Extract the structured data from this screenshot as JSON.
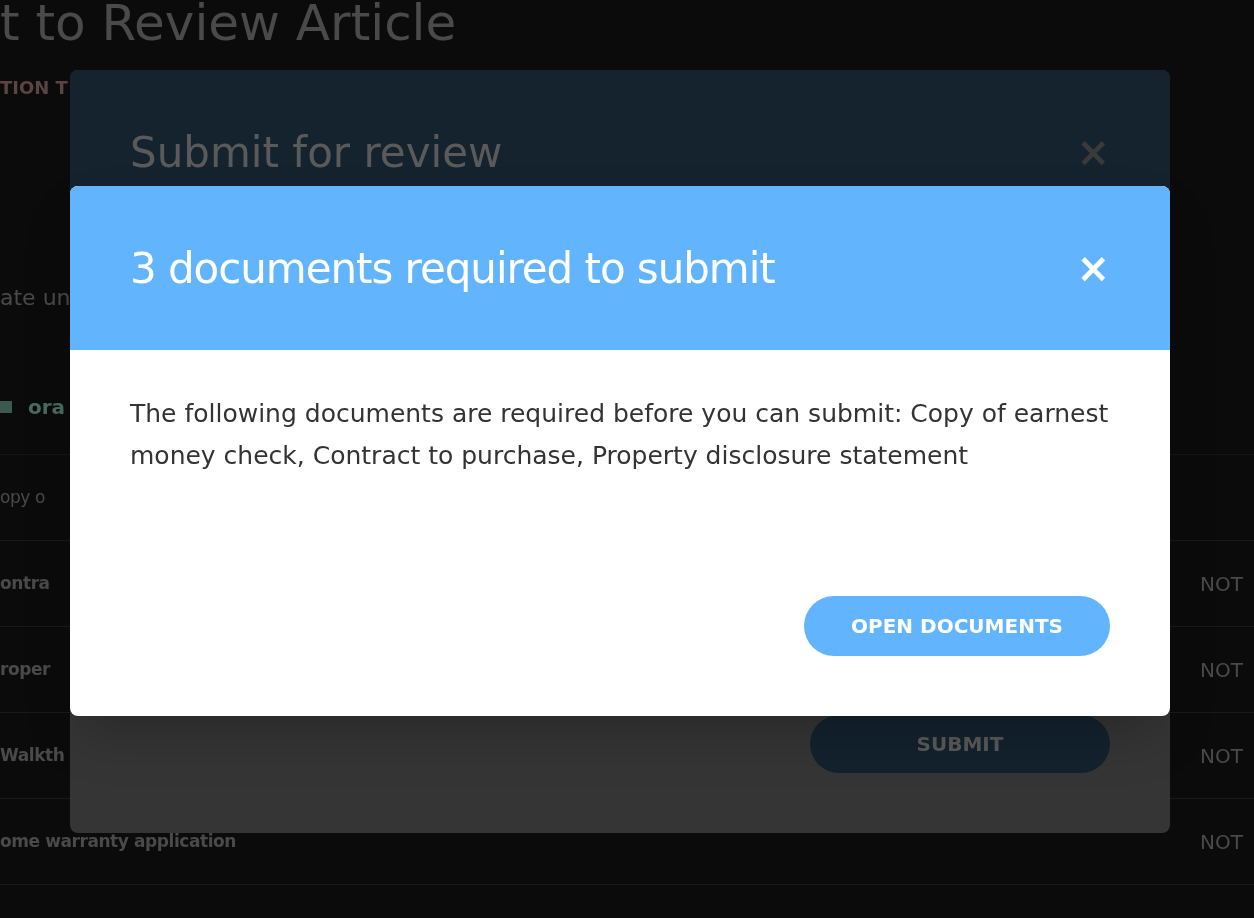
{
  "page": {
    "title": "t to Review Article",
    "subtitle": "TION T",
    "note": "ate un",
    "tab": "ora",
    "rows": [
      {
        "name": "opy o",
        "bold": false,
        "status": ""
      },
      {
        "name": "ontra",
        "bold": true,
        "status": "NOT"
      },
      {
        "name": "roper",
        "bold": true,
        "status": "NOT"
      },
      {
        "name": "Walkth",
        "bold": true,
        "status": "NOT"
      },
      {
        "name": "ome warranty application",
        "bold": true,
        "status": "NOT"
      }
    ]
  },
  "back_dialog": {
    "title": "Submit for review",
    "close": "×",
    "button": "SUBMIT"
  },
  "dialog": {
    "title": "3 documents required to submit",
    "close": "×",
    "message": "The following documents are required before you can submit: Copy of earnest money check, Contract to purchase, Property disclosure statement",
    "button": "OPEN DOCUMENTS"
  }
}
